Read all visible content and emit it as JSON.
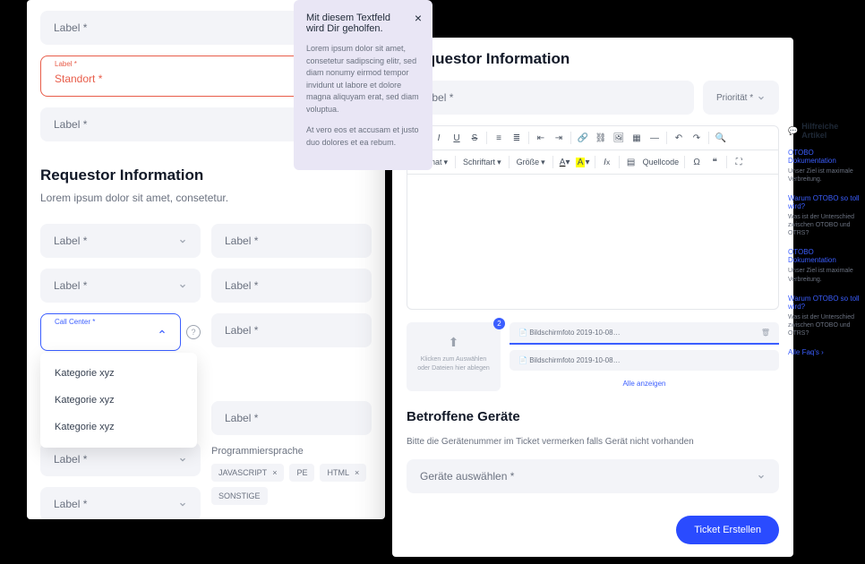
{
  "left": {
    "field1": "Label *",
    "error_tiny": "Label *",
    "error_main": "Standort *",
    "field3": "Label *",
    "section_title": "Requestor Information",
    "section_desc": "Lorem ipsum dolor sit amet, consetetur.",
    "grid": {
      "r1c1": "Label *",
      "r1c2": "Label *",
      "r2c1": "Label *",
      "r2c2": "Label *",
      "open_tiny": "Call Center *",
      "r3c2": "Label *",
      "r4c1": "Label *",
      "r4c2": "Label *",
      "r5c1": "Label *"
    },
    "dropdown": [
      "Kategorie xyz",
      "Kategorie xyz",
      "Kategorie xyz"
    ],
    "tags_label": "Programmiersprache",
    "tags": [
      "JAVASCRIPT",
      "PE",
      "HTML",
      "SONSTIGE"
    ]
  },
  "tooltip": {
    "title": "Mit diesem Textfeld wird Dir geholfen.",
    "p1": "Lorem ipsum dolor sit amet, consetetur sadipscing elitr, sed diam nonumy eirmod tempor invidunt ut labore et dolore magna aliquyam erat, sed diam voluptua.",
    "p2": "At vero eos et accusam et justo duo dolores et ea rebum."
  },
  "right": {
    "title": "Requestor Information",
    "label": "Label *",
    "priority": "Priorität *",
    "toolbar2": {
      "format": "Format",
      "font": "Schriftart",
      "size": "Größe",
      "source": "Quellcode"
    },
    "upload": {
      "line1": "Klicken zum Auswählen",
      "line2": "oder Dateien hier ablegen",
      "badge": "2"
    },
    "files": [
      "Bildschirmfoto 2019-10-08…",
      "Bildschirmfoto 2019-10-08…"
    ],
    "show_all": "Alle anzeigen",
    "devices_title": "Betroffene Geräte",
    "devices_desc": "Bitte die Gerätenummer im Ticket vermerken falls Gerät nicht vorhanden",
    "devices_field": "Geräte auswählen *",
    "submit": "Ticket Erstellen"
  },
  "sidebar": {
    "title": "Hilfreiche Artikel",
    "articles": [
      {
        "title": "OTOBO Dokumentation",
        "desc": "Unser Ziel ist maximale Verbreitung."
      },
      {
        "title": "Warum OTOBO so toll wird?",
        "desc": "Was ist der Unterschied zwischen OTOBO und OTRS?"
      },
      {
        "title": "OTOBO Dokumentation",
        "desc": "Unser Ziel ist maximale Verbreitung."
      },
      {
        "title": "Warum OTOBO so toll wird?",
        "desc": "Was ist der Unterschied zwischen OTOBO und OTRS?"
      }
    ],
    "all": "Alle Faq's ›"
  }
}
